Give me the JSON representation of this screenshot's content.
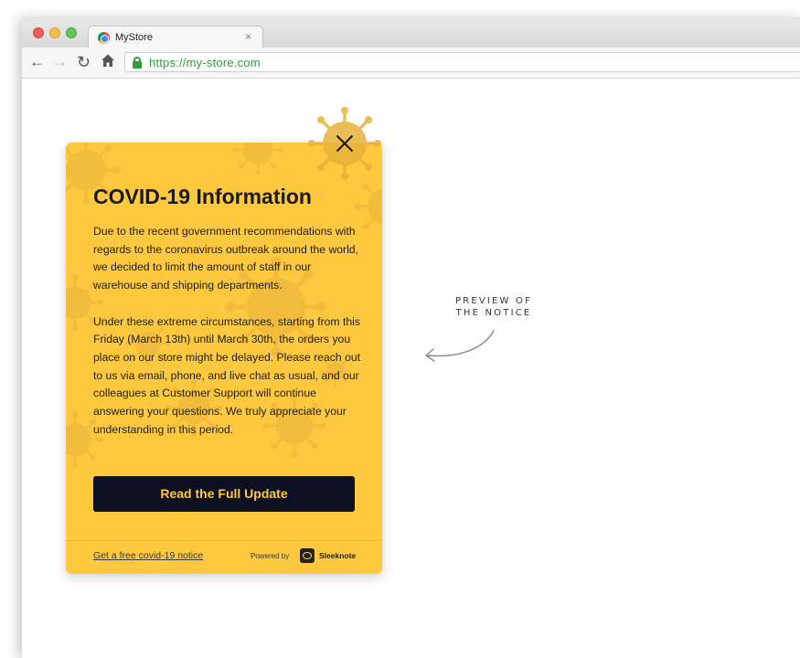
{
  "browser": {
    "tab": {
      "title": "MyStore",
      "close_symbol": "×"
    },
    "url": "https://my-store.com",
    "nav_icons": [
      "back-arrow-icon",
      "forward-arrow-icon",
      "reload-icon",
      "home-icon",
      "lock-icon"
    ]
  },
  "notice": {
    "title": "COVID-19 Information",
    "paragraphs": [
      "Due to the recent government recommendations with regards to the coronavirus outbreak around the world, we decided to limit the amount of staff in our warehouse and shipping departments.",
      "Under these extreme circumstances, starting from this Friday (March 13th) until March 30th, the orders you place on our store might be delayed. Please reach out to us via email, phone, and live chat as usual, and our colleagues at Customer Support will continue answering your questions. We truly appreciate your understanding in this period."
    ],
    "cta_label": "Read the Full Update",
    "footer_link": "Get a free covid-19 notice",
    "powered_by": "Powered by",
    "brand": "Sleeknote",
    "colors": {
      "background": "#fec93f",
      "button": "#0c1020",
      "button_text": "#fec93f"
    }
  },
  "annotation": {
    "line1": "PREVIEW OF",
    "line2": "THE NOTICE"
  }
}
